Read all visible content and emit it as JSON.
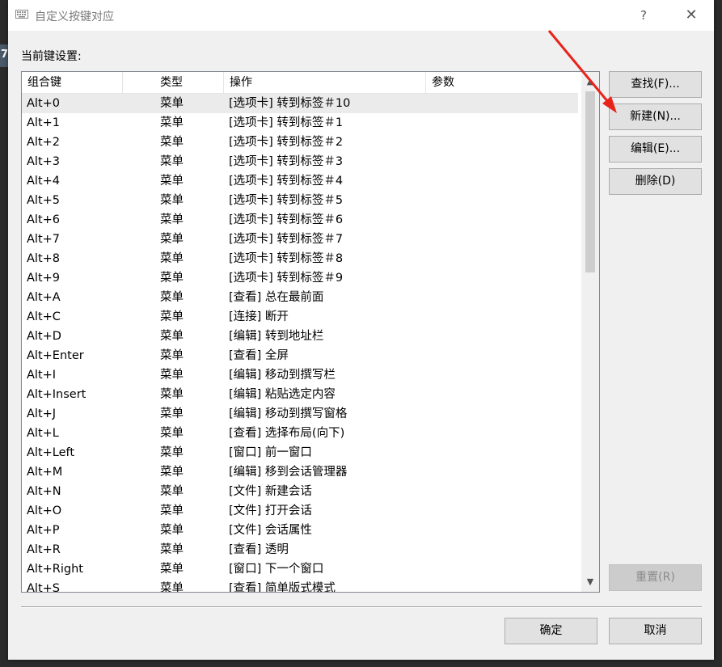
{
  "background": {
    "edge_text": "7"
  },
  "window": {
    "title": "自定义按键对应",
    "help_label": "?",
    "close_label": "✕",
    "icon": "keyboard-icon"
  },
  "section_label": "当前键设置:",
  "table": {
    "columns": [
      "组合键",
      "类型",
      "操作",
      "参数"
    ],
    "rows": [
      {
        "key": "Alt+0",
        "type": "菜单",
        "action": "[选项卡] 转到标签＃10",
        "param": ""
      },
      {
        "key": "Alt+1",
        "type": "菜单",
        "action": "[选项卡] 转到标签＃1",
        "param": ""
      },
      {
        "key": "Alt+2",
        "type": "菜单",
        "action": "[选项卡] 转到标签＃2",
        "param": ""
      },
      {
        "key": "Alt+3",
        "type": "菜单",
        "action": "[选项卡] 转到标签＃3",
        "param": ""
      },
      {
        "key": "Alt+4",
        "type": "菜单",
        "action": "[选项卡] 转到标签＃4",
        "param": ""
      },
      {
        "key": "Alt+5",
        "type": "菜单",
        "action": "[选项卡] 转到标签＃5",
        "param": ""
      },
      {
        "key": "Alt+6",
        "type": "菜单",
        "action": "[选项卡] 转到标签＃6",
        "param": ""
      },
      {
        "key": "Alt+7",
        "type": "菜单",
        "action": "[选项卡] 转到标签＃7",
        "param": ""
      },
      {
        "key": "Alt+8",
        "type": "菜单",
        "action": "[选项卡] 转到标签＃8",
        "param": ""
      },
      {
        "key": "Alt+9",
        "type": "菜单",
        "action": "[选项卡] 转到标签＃9",
        "param": ""
      },
      {
        "key": "Alt+A",
        "type": "菜单",
        "action": "[查看] 总在最前面",
        "param": ""
      },
      {
        "key": "Alt+C",
        "type": "菜单",
        "action": "[连接] 断开",
        "param": ""
      },
      {
        "key": "Alt+D",
        "type": "菜单",
        "action": "[编辑] 转到地址栏",
        "param": ""
      },
      {
        "key": "Alt+Enter",
        "type": "菜单",
        "action": "[查看] 全屏",
        "param": ""
      },
      {
        "key": "Alt+I",
        "type": "菜单",
        "action": "[编辑] 移动到撰写栏",
        "param": ""
      },
      {
        "key": "Alt+Insert",
        "type": "菜单",
        "action": "[编辑] 粘贴选定内容",
        "param": ""
      },
      {
        "key": "Alt+J",
        "type": "菜单",
        "action": "[编辑] 移动到撰写窗格",
        "param": ""
      },
      {
        "key": "Alt+L",
        "type": "菜单",
        "action": "[查看] 选择布局(向下)",
        "param": ""
      },
      {
        "key": "Alt+Left",
        "type": "菜单",
        "action": "[窗口] 前一窗口",
        "param": ""
      },
      {
        "key": "Alt+M",
        "type": "菜单",
        "action": "[编辑] 移到会话管理器",
        "param": ""
      },
      {
        "key": "Alt+N",
        "type": "菜单",
        "action": "[文件] 新建会话",
        "param": ""
      },
      {
        "key": "Alt+O",
        "type": "菜单",
        "action": "[文件] 打开会话",
        "param": ""
      },
      {
        "key": "Alt+P",
        "type": "菜单",
        "action": "[文件] 会话属性",
        "param": ""
      },
      {
        "key": "Alt+R",
        "type": "菜单",
        "action": "[查看] 透明",
        "param": ""
      },
      {
        "key": "Alt+Right",
        "type": "菜单",
        "action": "[窗口] 下一个窗口",
        "param": ""
      },
      {
        "key": "Alt+S",
        "type": "菜单",
        "action": "[查看] 简单版式模式",
        "param": ""
      }
    ],
    "selected_index": 0
  },
  "buttons": {
    "find": "查找(F)...",
    "new": "新建(N)...",
    "edit": "编辑(E)...",
    "delete": "删除(D)",
    "reset": "重置(R)",
    "ok": "确定",
    "cancel": "取消"
  },
  "scrollbar": {
    "up_icon": "▲",
    "down_icon": "▼"
  },
  "colors": {
    "annotation_arrow": "#e8231c",
    "dialog_bg": "#f0f0f0",
    "selected_row": "#ebebeb"
  }
}
